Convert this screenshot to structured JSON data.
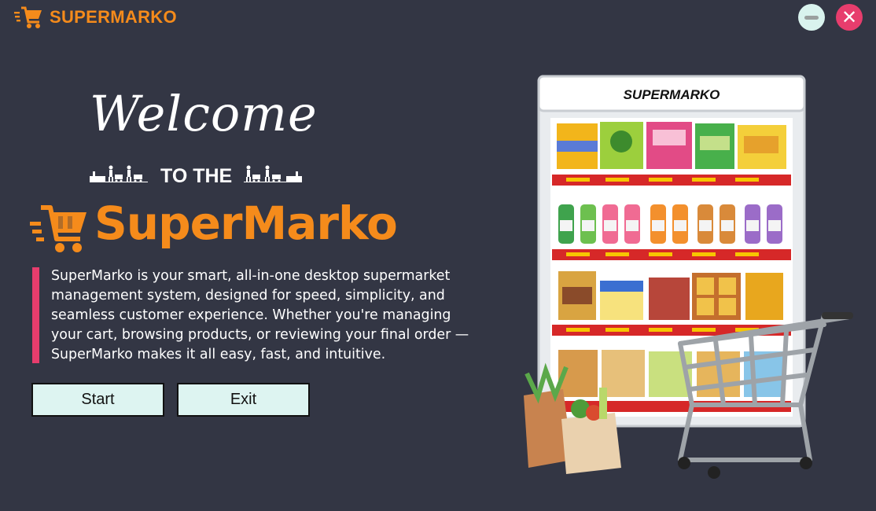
{
  "titlebar": {
    "app_name": "SUPERMARKO",
    "logo_icon": "shopping-cart-icon",
    "minimize_icon": "minimize-icon",
    "close_icon": "close-icon",
    "close_glyph": "✕"
  },
  "hero": {
    "welcome": "Welcome",
    "to_the": "TO THE",
    "brand": "SuperMarko",
    "description": "SuperMarko is your smart, all-in-one desktop supermarket management system, designed for speed, simplicity, and seamless customer experience. Whether you're managing your cart, browsing products, or reviewing your final order — SuperMarko makes it all easy, fast, and intuitive."
  },
  "buttons": {
    "start": "Start",
    "exit": "Exit"
  },
  "illustration": {
    "fridge_label": "SUPERMARKO"
  },
  "colors": {
    "background": "#333644",
    "accent_orange": "#F58B1B",
    "accent_pink": "#E73D6D",
    "button_bg": "#DDF4F1",
    "minimize_bg": "#D9F3EE"
  }
}
